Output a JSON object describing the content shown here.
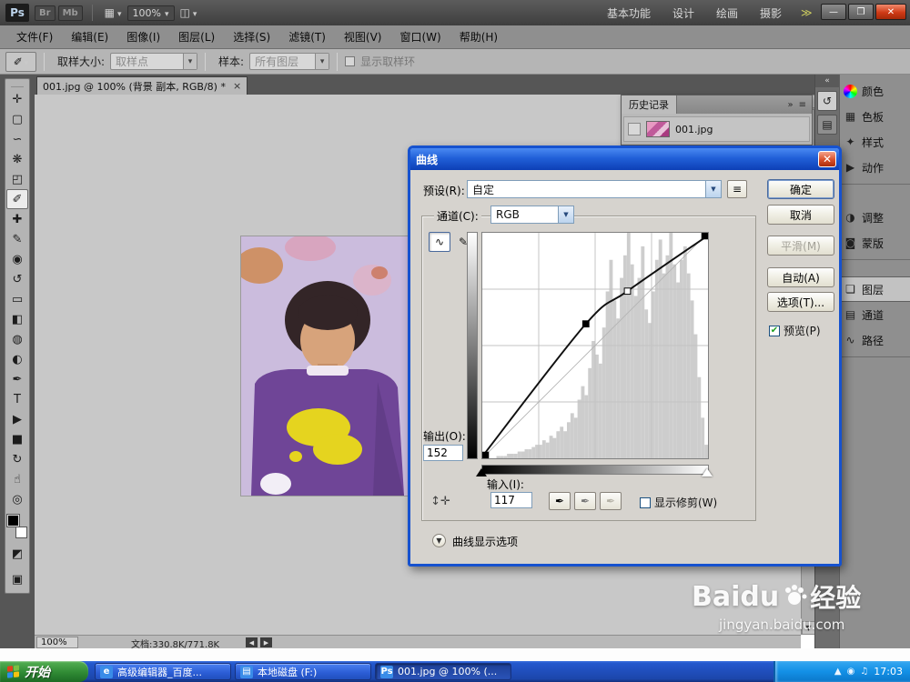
{
  "titlebar": {
    "logo": "Ps",
    "bridge": "Br",
    "minibridge": "Mb",
    "arrange_icon": "▦",
    "screen_icon": "◫",
    "zoom": "100%",
    "workspaces": [
      {
        "label": "基本功能"
      },
      {
        "label": "设计"
      },
      {
        "label": "绘画"
      },
      {
        "label": "摄影"
      }
    ],
    "overflow": "≫"
  },
  "menubar": {
    "items": [
      {
        "label": "文件(F)"
      },
      {
        "label": "编辑(E)"
      },
      {
        "label": "图像(I)"
      },
      {
        "label": "图层(L)"
      },
      {
        "label": "选择(S)"
      },
      {
        "label": "滤镜(T)"
      },
      {
        "label": "视图(V)"
      },
      {
        "label": "窗口(W)"
      },
      {
        "label": "帮助(H)"
      }
    ]
  },
  "optionsbar": {
    "tool_icon": "✐",
    "sample_size_label": "取样大小:",
    "sample_size_value": "取样点",
    "sample_label": "样本:",
    "sample_value": "所有图层",
    "show_ring_label": "显示取样环"
  },
  "tools": [
    {
      "name": "move-tool",
      "glyph": "✛"
    },
    {
      "name": "marquee-tool",
      "glyph": "▢"
    },
    {
      "name": "lasso-tool",
      "glyph": "∽"
    },
    {
      "name": "quick-selection-tool",
      "glyph": "❋"
    },
    {
      "name": "crop-tool",
      "glyph": "◰"
    },
    {
      "name": "eyedropper-tool",
      "glyph": "✐"
    },
    {
      "name": "healing-brush-tool",
      "glyph": "✚"
    },
    {
      "name": "brush-tool",
      "glyph": "✎"
    },
    {
      "name": "clone-stamp-tool",
      "glyph": "◉"
    },
    {
      "name": "history-brush-tool",
      "glyph": "↺"
    },
    {
      "name": "eraser-tool",
      "glyph": "▭"
    },
    {
      "name": "gradient-tool",
      "glyph": "◧"
    },
    {
      "name": "blur-tool",
      "glyph": "◍"
    },
    {
      "name": "dodge-tool",
      "glyph": "◐"
    },
    {
      "name": "pen-tool",
      "glyph": "✒"
    },
    {
      "name": "type-tool",
      "glyph": "T"
    },
    {
      "name": "path-selection-tool",
      "glyph": "▶"
    },
    {
      "name": "shape-tool",
      "glyph": "■"
    },
    {
      "name": "rotate-view-tool",
      "glyph": "↻"
    },
    {
      "name": "hand-tool",
      "glyph": "☝"
    },
    {
      "name": "zoom-tool",
      "glyph": "◎"
    }
  ],
  "tabbar": {
    "title": "001.jpg @ 100% (背景 副本, RGB/8) *",
    "close": "×"
  },
  "history": {
    "title": "历史记录",
    "entry": "001.jpg"
  },
  "strip": [
    {
      "name": "history-panel-icon",
      "glyph": "↺",
      "cls": "active"
    },
    {
      "name": "collapsed-panel-icon",
      "glyph": "▤",
      "cls": ""
    }
  ],
  "dock": {
    "group1": [
      {
        "name": "dock-color",
        "glyph": "●",
        "label": "颜色"
      },
      {
        "name": "dock-swatches",
        "glyph": "▦",
        "label": "色板"
      },
      {
        "name": "dock-styles",
        "glyph": "✦",
        "label": "样式"
      },
      {
        "name": "dock-actions",
        "glyph": "▶",
        "label": "动作"
      }
    ],
    "group2": [
      {
        "name": "dock-adjustments",
        "glyph": "◑",
        "label": "调整"
      },
      {
        "name": "dock-masks",
        "glyph": "◙",
        "label": "蒙版"
      }
    ],
    "group3": [
      {
        "name": "dock-layers",
        "glyph": "❏",
        "label": "图层"
      },
      {
        "name": "dock-channels",
        "glyph": "▤",
        "label": "通道"
      },
      {
        "name": "dock-paths",
        "glyph": "∿",
        "label": "路径"
      }
    ]
  },
  "curves_dialog": {
    "title": "曲线",
    "preset_label": "预设(R):",
    "preset_value": "自定",
    "channel_label": "通道(C):",
    "channel_value": "RGB",
    "output_label": "输出(O):",
    "output_value": "152",
    "input_label": "输入(I):",
    "input_value": "117",
    "show_clipping_label": "显示修剪(W)",
    "display_options_label": "曲线显示选项",
    "ok": "确定",
    "cancel": "取消",
    "smooth": "平滑(M)",
    "auto": "自动(A)",
    "options": "选项(T)...",
    "preview": "预览(P)",
    "chart": {
      "type": "line",
      "x_label": "输入",
      "y_label": "输出",
      "x_range": [
        0,
        255
      ],
      "y_range": [
        0,
        255
      ],
      "grid": "quarters",
      "points": [
        [
          0,
          2,
          "anchor"
        ],
        [
          117,
          152,
          "selected"
        ],
        [
          164,
          189,
          "point"
        ],
        [
          255,
          252,
          "anchor"
        ]
      ],
      "selected": [
        117,
        152
      ],
      "histogram": [
        0,
        0,
        0,
        0,
        1,
        1,
        1,
        2,
        2,
        2,
        3,
        3,
        4,
        4,
        5,
        6,
        6,
        8,
        7,
        10,
        9,
        12,
        14,
        12,
        16,
        20,
        18,
        26,
        32,
        28,
        40,
        52,
        46,
        42,
        58,
        74,
        88,
        70,
        62,
        80,
        90,
        100,
        86,
        72,
        80,
        94,
        66,
        60,
        74,
        88,
        97,
        82,
        90,
        100,
        86,
        78,
        88,
        94,
        82,
        70,
        55,
        36,
        18,
        6
      ]
    }
  },
  "statusbar": {
    "zoom": "100%",
    "doc": "文档:330.8K/771.8K"
  },
  "watermark": {
    "brand": "Baidu",
    "brand_cn": "经验",
    "url": "jingyan.baidu.com"
  },
  "taskbar": {
    "start_label": "开始",
    "tasks": [
      {
        "name": "task-editor",
        "icon": "e",
        "label": "高级编辑器_百度..."
      },
      {
        "name": "task-disk",
        "icon": "▤",
        "label": "本地磁盘 (F:)"
      },
      {
        "name": "task-photoshop",
        "icon": "Ps",
        "label": "001.jpg @ 100% (..."
      }
    ],
    "tray_icons": [
      {
        "name": "tray-hidden-icons-icon",
        "glyph": "▲"
      },
      {
        "name": "tray-network-icon",
        "glyph": "◉"
      },
      {
        "name": "tray-volume-icon",
        "glyph": "♫"
      }
    ],
    "time": "17:03"
  }
}
